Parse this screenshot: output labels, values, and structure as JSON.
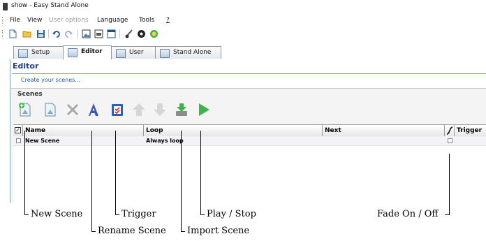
{
  "window": {
    "title": "show - Easy Stand Alone"
  },
  "menu": {
    "file": "File",
    "view": "View",
    "user_options": "User options",
    "language": "Language",
    "tools": "Tools",
    "help": "?"
  },
  "toolbar": {
    "icons": [
      "new-document-icon",
      "open-folder-icon",
      "save-icon",
      "undo-icon",
      "redo-icon",
      "picture-icon",
      "grid-icon",
      "window-icon",
      "brush-icon",
      "midi-icon",
      "color-wheel-icon"
    ]
  },
  "tabs": [
    {
      "label": "Setup",
      "active": false
    },
    {
      "label": "Editor",
      "active": true
    },
    {
      "label": "User",
      "active": false
    },
    {
      "label": "Stand Alone",
      "active": false
    }
  ],
  "panel": {
    "title": "Editor",
    "subtitle": "Create your scenes...",
    "scenes_label": "Scenes"
  },
  "grid": {
    "columns": [
      "Name",
      "Loop",
      "Next",
      "Trigger"
    ],
    "rows": [
      {
        "name": "New Scene",
        "loop": "Always loop",
        "next": "",
        "fade_checked": false,
        "selected": true
      }
    ]
  },
  "callouts": {
    "new_scene": "New Scene",
    "rename_scene": "Rename Scene",
    "trigger": "Trigger",
    "import_scene": "Import Scene",
    "play_stop": "Play / Stop",
    "fade": "Fade On / Off"
  },
  "colors": {
    "accent_blue": "#1f3f8a",
    "link_blue": "#2255aa",
    "play_green": "#3cb44b",
    "delete_gray": "#a8a8a8"
  }
}
